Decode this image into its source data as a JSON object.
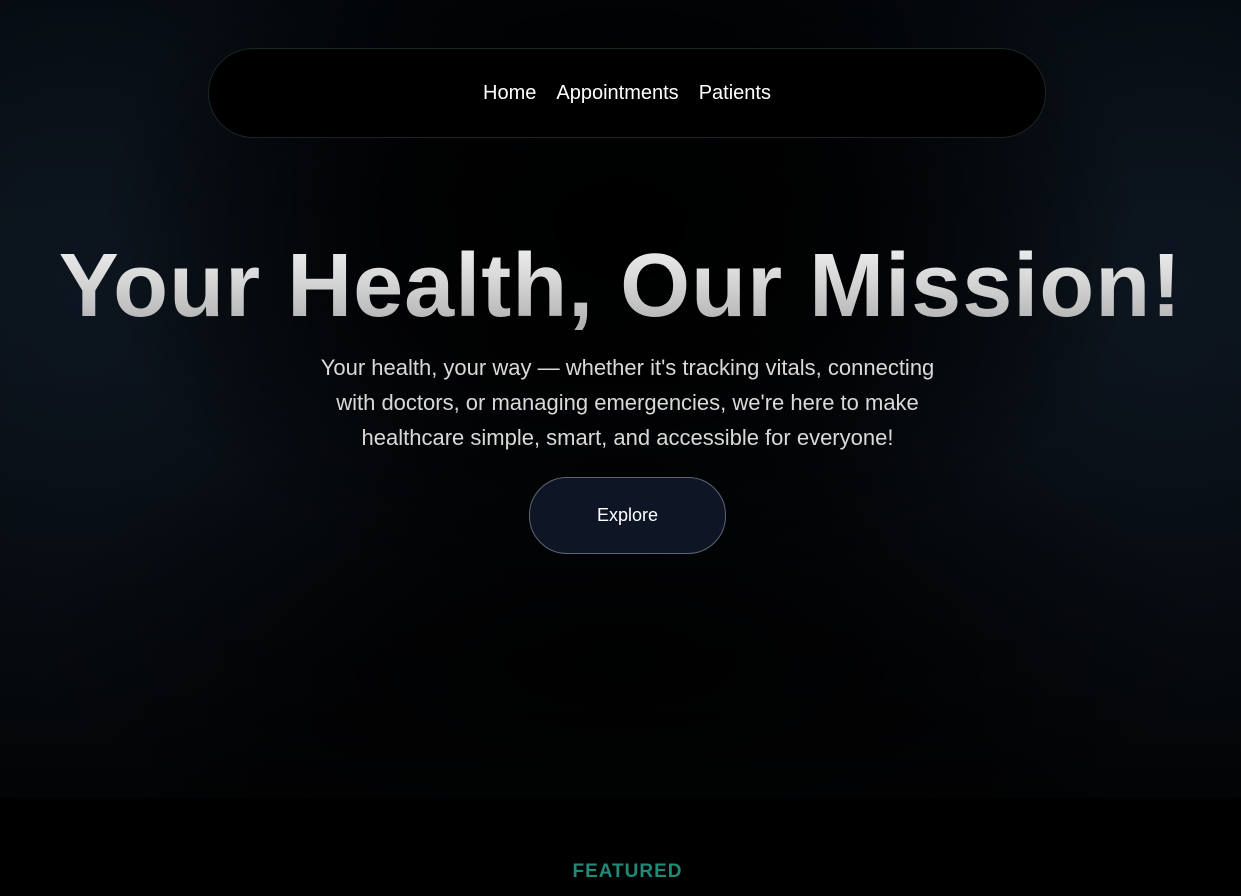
{
  "nav": {
    "items": [
      {
        "label": "Home"
      },
      {
        "label": "Appointments"
      },
      {
        "label": "Patients"
      }
    ]
  },
  "hero": {
    "title": "Your Health, Our Mission!",
    "subtitle": "Your health, your way — whether it's tracking vitals, connecting with doctors, or managing emergencies, we're here to make healthcare simple, smart, and accessible for everyone!",
    "cta_label": "Explore"
  },
  "featured": {
    "label": "FEATURED"
  },
  "colors": {
    "background": "#000000",
    "button_bg": "#0e1626",
    "accent": "#1f8a78",
    "nav_border": "#1a2624"
  }
}
